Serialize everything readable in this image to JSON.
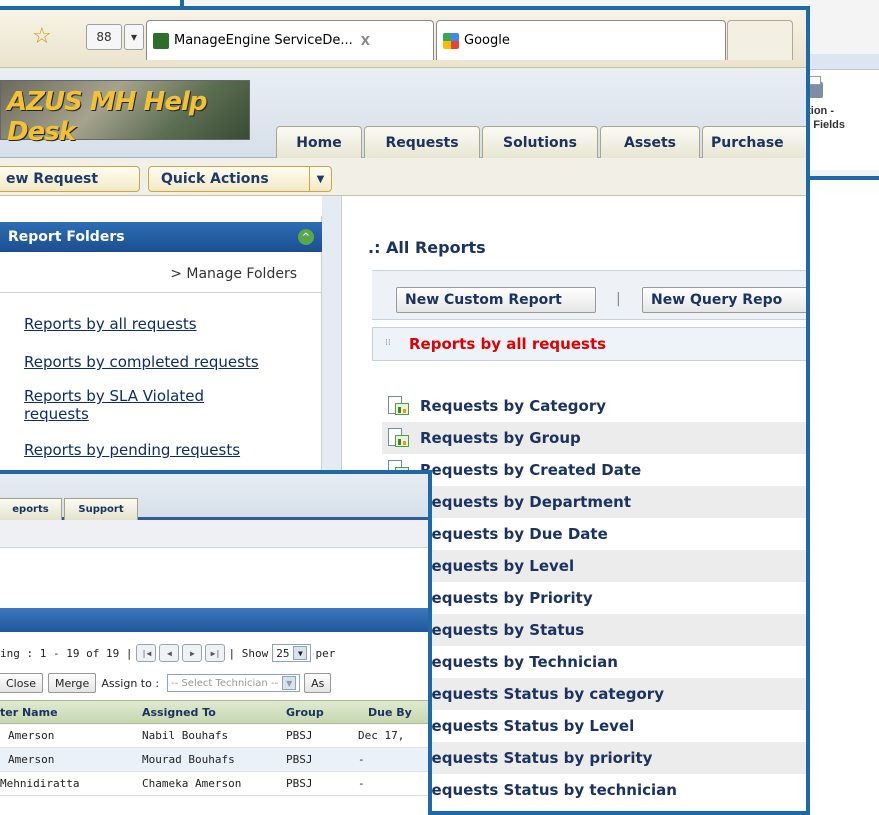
{
  "back_window": {
    "toolbar_label_line1": "ation -",
    "toolbar_label_line2": "al Fields"
  },
  "browser": {
    "tabs": [
      {
        "title": "ManageEngine ServiceDe...",
        "close": "X"
      },
      {
        "title": "Google"
      }
    ],
    "grid_btn": "88",
    "dropdown": "▾",
    "star_icon": "☆"
  },
  "app": {
    "logo_text_a": "AZUS",
    "logo_text_b": "MH Help Desk",
    "nav_tabs": [
      "Home",
      "Requests",
      "Solutions",
      "Assets",
      "Purchase"
    ],
    "new_request": "ew Request",
    "quick_actions": "Quick Actions"
  },
  "folders": {
    "header": "Report Folders",
    "manage": "> Manage Folders",
    "links": [
      "Reports by all requests",
      "Reports by completed requests",
      "Reports by SLA Violated",
      "requests",
      "Reports by pending requests"
    ]
  },
  "content": {
    "title": ".: All Reports",
    "new_custom_report": "New Custom Report",
    "new_query_report": "New Query Repo",
    "separator": "|",
    "section": "Reports by all requests",
    "reports": [
      "Requests by Category",
      "Requests by Group",
      "Requests by Created Date",
      "Requests by Department",
      "Requests by Due Date",
      "Requests by Level",
      "Requests by Priority",
      "Requests by Status",
      "Requests by Technician",
      "Requests Status by category",
      "Requests Status by Level",
      "Requests Status by priority",
      "Requests Status by technician"
    ]
  },
  "request_window": {
    "tabs": [
      "eports",
      "Support"
    ],
    "pager_text": "ing : 1 - 19 of 19 |",
    "show_label": "| Show",
    "show_value": "25",
    "per_label": "per",
    "close_btn": "Close",
    "merge_btn": "Merge",
    "assign_label": "Assign to :",
    "assign_placeholder": "-- Select Technician --",
    "assign_btn": "As",
    "columns": [
      "ter Name",
      "Assigned To",
      "Group",
      "Due By"
    ],
    "rows": [
      [
        "Amerson",
        "Nabil Bouhafs",
        "PBSJ",
        "Dec 17,"
      ],
      [
        "Amerson",
        "Mourad Bouhafs",
        "PBSJ",
        "-"
      ],
      [
        "Mehnidiratta",
        "Chameka Amerson",
        "PBSJ",
        "-"
      ]
    ]
  }
}
